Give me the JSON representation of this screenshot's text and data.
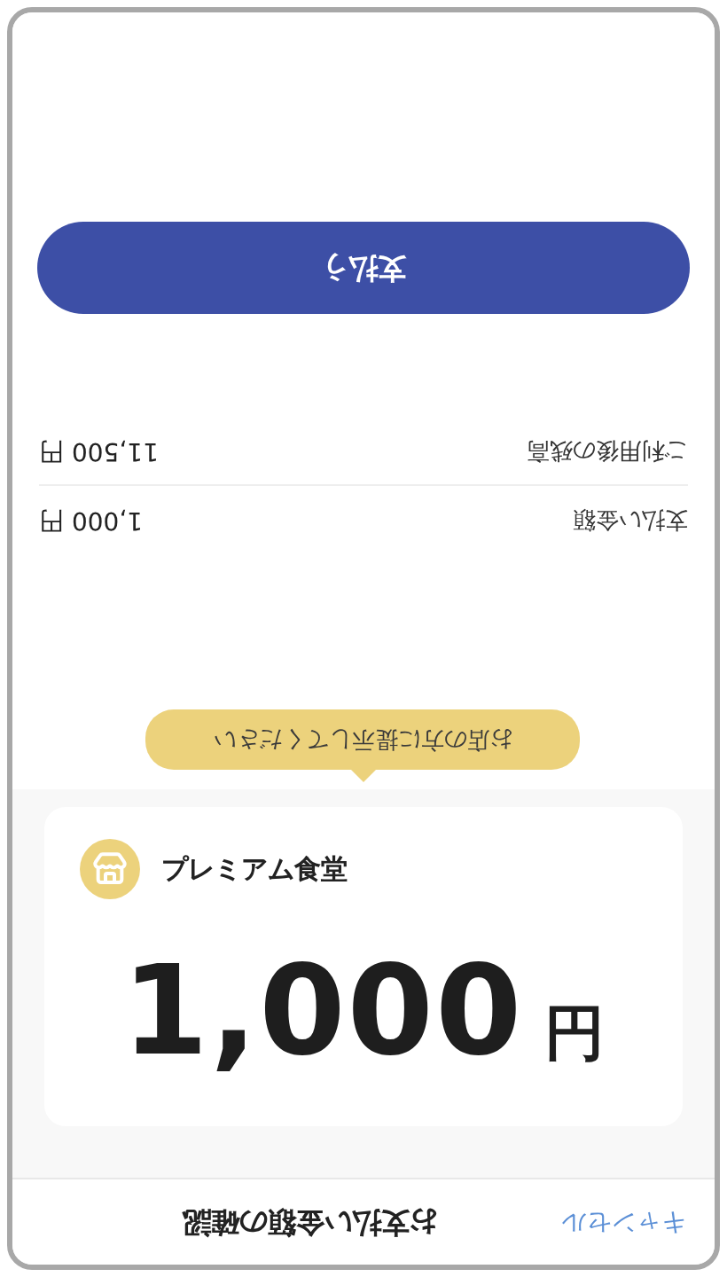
{
  "header": {
    "title": "お支払い金額の確認",
    "cancel": "キャンセル"
  },
  "store": {
    "name": "プレミアム食堂",
    "amount": "1,000",
    "currency": "円"
  },
  "tooltip": "お店の方に提示してください",
  "details": [
    {
      "label": "支払い金額",
      "value": "1,000 円"
    },
    {
      "label": "ご利用後の残高",
      "value": "11,500 円"
    }
  ],
  "pay_button": "支払う"
}
